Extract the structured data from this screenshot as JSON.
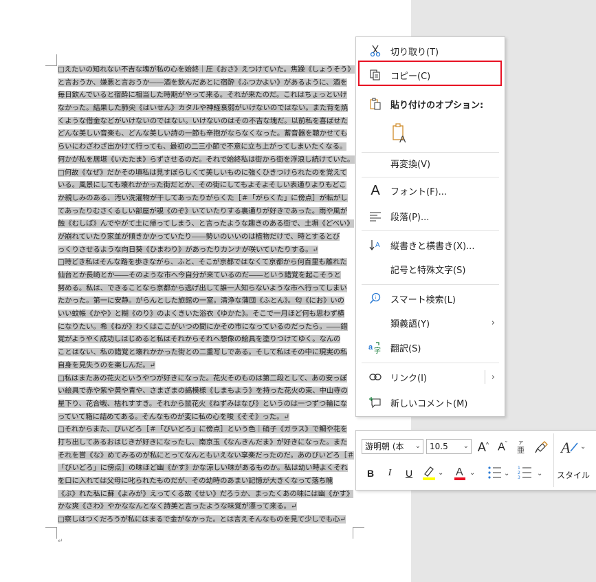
{
  "document": {
    "lines": [
      "□えたいの知れない不吉な塊が私の心を始終｜圧《おさ》えつけていた。焦躁《しょうそう》",
      "と言おうか、嫌悪と言おうか――酒を飲んだあとに宿酔《ふつかよい》があるように、酒を",
      "毎日飲んでいると宿酔に相当した時期がやって来る。それが来たのだ。これはちょっといけ",
      "なかった。結果した肺尖《はいせん》カタルや神経衰弱がいけないのではない。また背を焼",
      "くような借金などがいけないのではない。いけないのはその不吉な塊だ。以前私を喜ばせた",
      "どんな美しい音楽も、どんな美しい詩の一節も辛抱がならなくなった。蓄音器を聴かせても",
      "らいにわざわざ出かけて行っても、最初の二三小節で不意に立ち上がってしまいたくなる。",
      "何かが私を居堪《いたたま》らずさせるのだ。それで始終私は街から街を浮浪し続けていた。↵",
      "□何故《なぜ》だかその頃私は見すぼらしくて美しいものに強くひきつけられたのを覚えて",
      "いる。風景にしても壊れかかった街だとか、その街にしてもよそよそしい表通りよりもどこ",
      "か親しみのある、汚い洗濯物が干してあったりがらくた［＃「がらくた」に傍点］が転がし",
      "てあったりむさくるしい部屋が覗《のぞ》いていたりする裏通りが好きであった。雨や風が",
      "蝕《むしば》んでやがて土に帰ってしまう、と言ったような趣きのある街で、土塀《どべい》",
      "が崩れていたり家並が傾きかかっていたり――勢いのいいのは植物だけで、時とするとび",
      "っくりさせるような向日葵《ひまわり》があったりカンナが咲いていたりする。↵",
      "□時どき私はそんな路を歩きながら、ふと、そこが京都ではなくて京都から何百里も離れた",
      "仙台とか長崎とか――そのような市へ今自分が来ているのだ――という錯覚を起こそうと",
      "努める。私は、できることなら京都から逃げ出して誰一人知らないような市へ行ってしまい",
      "たかった。第一に安静。がらんとした旅館の一室。清浄な蒲団《ふとん》。匂《にお》いの",
      "いい蚊帳《かや》と糊《のり》のよくきいた浴衣《ゆかた》。そこで一月ほど何も思わず横",
      "になりたい。希《ねが》わくはここがいつの間にかその市になっているのだったら。――錯",
      "覚がようやく成功しはじめると私はそれからそれへ想像の絵具を塗りつけてゆく。なんの",
      "ことはない、私の錯覚と壊れかかった街との二重写しである。そして私はその中に現実の私",
      "自身を見失うのを楽しんだ。↵",
      "□私はまたあの花火というやつが好きになった。花火そのものは第二段として、あの安っぽ",
      "い絵具で赤や紫や黄や青や、さまざまの縞模様《しまもよう》を持った花火の束、中山寺の",
      "星下り、花合戦、枯れすすき。それから鼠花火《ねずみはなび》というのは一つずつ輪にな",
      "っていて箱に詰めてある。そんなものが変に私の心を唆《そそ》った。↵",
      "□それからまた、びいどろ［＃「びいどろ」に傍点］という色｜硝子《ガラス》で鯛や花を",
      "打ち出してあるおはじきが好きになったし、南京玉《なんきんだま》が好きになった。また",
      "それを嘗《な》めてみるのが私にとってなんともいえない享楽だったのだ。あのびいどろ［＃",
      "「びいどろ」に傍点］の味ほど幽《かす》かな涼しい味があるものか。私は幼い時よくそれ",
      "を口に入れては父母に叱られたものだが、その幼時のあまい記憶が大きくなって落ち魄",
      "《ぶ》れた私に蘇《よみが》えってくる故《せい》だろうか、まったくあの味には幽《かす》",
      "かな爽《さわ》やかななんとなく詩美と言ったような味覚が漂って来る。↵",
      "□察しはつくだろうが私にはまるで金がなかった。とは言えそんなものを見て少しでも心↵"
    ],
    "end_mark": "↵"
  },
  "context_menu": {
    "items": [
      {
        "label": "切り取り(T)",
        "icon": "scissors-icon"
      },
      {
        "label": "コピー(C)",
        "icon": "copy-icon"
      },
      {
        "label": "貼り付けのオプション:",
        "icon": "paste-options-icon"
      },
      {
        "label": "",
        "icon": "paste-text-only-icon"
      },
      {
        "label": "再変換(V)",
        "icon": ""
      },
      {
        "label": "フォント(F)...",
        "icon": "font-icon"
      },
      {
        "label": "段落(P)...",
        "icon": "paragraph-icon"
      },
      {
        "label": "縦書きと横書き(X)...",
        "icon": "text-direction-icon"
      },
      {
        "label": "記号と特殊文字(S)",
        "icon": ""
      },
      {
        "label": "スマート検索(L)",
        "icon": "smart-search-icon"
      },
      {
        "label": "類義語(Y)",
        "icon": ""
      },
      {
        "label": "翻訳(S)",
        "icon": "translate-icon"
      },
      {
        "label": "リンク(I)",
        "icon": "link-icon"
      },
      {
        "label": "新しいコメント(M)",
        "icon": "new-comment-icon"
      }
    ],
    "highlight_color": "#e81123"
  },
  "mini_toolbar": {
    "font_name": "游明朝 (本",
    "font_size": "10.5",
    "style_label": "スタイル",
    "bold": "B",
    "italic": "I",
    "underline": "U",
    "highlight_color": "#ffff00",
    "font_color": "#e81123"
  }
}
